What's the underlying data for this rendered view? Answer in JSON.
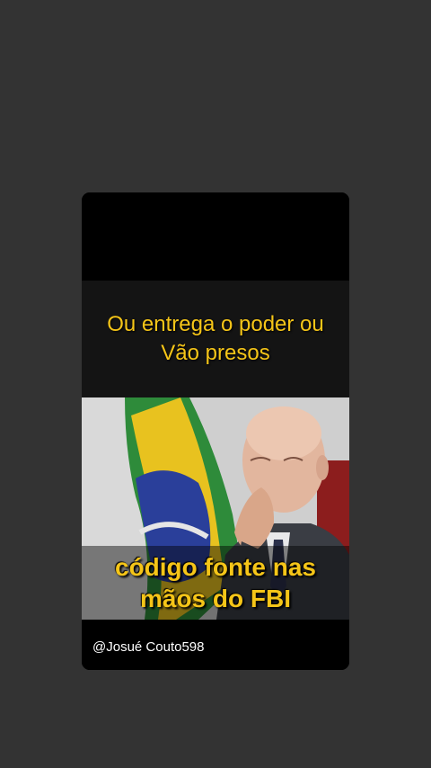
{
  "post": {
    "headline_lines": [
      "Ou entrega o poder ou",
      "Vão presos"
    ],
    "caption_lines": [
      "código fonte nas",
      "mãos do FBI"
    ],
    "watermark_handle": "@Josué Couto598"
  },
  "colors": {
    "background": "#333333",
    "card": "#000000",
    "headline_band": "#141414",
    "text_accent": "#f5c518",
    "handle_text": "#ffffff"
  }
}
